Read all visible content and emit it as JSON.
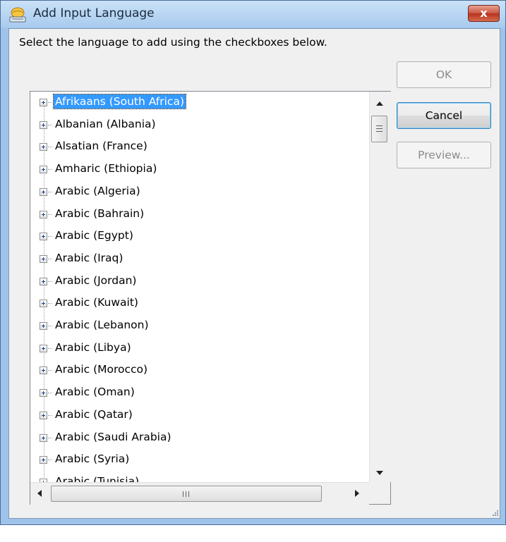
{
  "window": {
    "title": "Add Input Language",
    "title_icon": "keyboard-globe-icon",
    "close_label": "x"
  },
  "instruction": "Select the language to add using the checkboxes below.",
  "buttons": {
    "ok": "OK",
    "cancel": "Cancel",
    "preview": "Preview..."
  },
  "language_list": {
    "selected_index": 0,
    "items": [
      "Afrikaans (South Africa)",
      "Albanian (Albania)",
      "Alsatian (France)",
      "Amharic (Ethiopia)",
      "Arabic (Algeria)",
      "Arabic (Bahrain)",
      "Arabic (Egypt)",
      "Arabic (Iraq)",
      "Arabic (Jordan)",
      "Arabic (Kuwait)",
      "Arabic (Lebanon)",
      "Arabic (Libya)",
      "Arabic (Morocco)",
      "Arabic (Oman)",
      "Arabic (Qatar)",
      "Arabic (Saudi Arabia)",
      "Arabic (Syria)",
      "Arabic (Tunisia)"
    ]
  },
  "colors": {
    "selection": "#3399ff",
    "title_bar": "#a9cbee",
    "close_button": "#c85642"
  }
}
